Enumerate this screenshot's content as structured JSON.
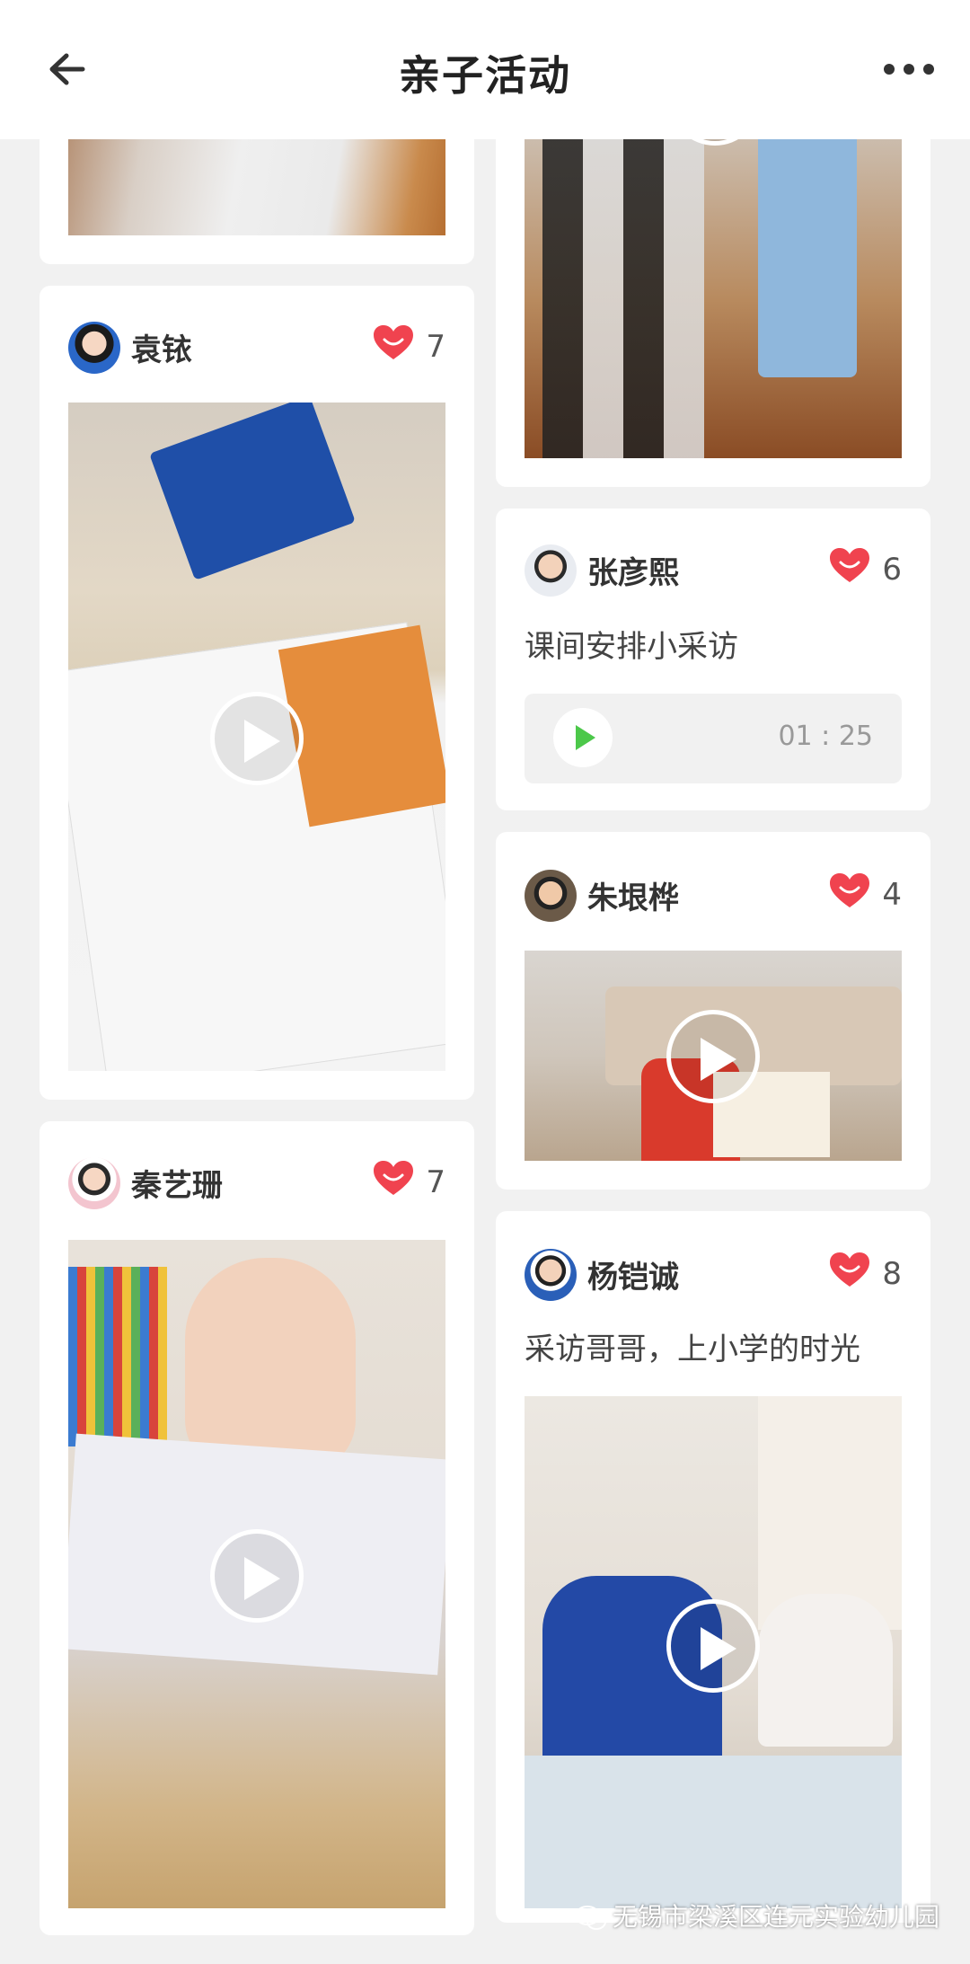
{
  "header": {
    "title": "亲子活动"
  },
  "posts": [
    {
      "name": "袁铱",
      "likes": "7"
    },
    {
      "name": "秦艺珊",
      "likes": "7"
    },
    {
      "name": "张彦熙",
      "likes": "6",
      "caption": "课间安排小采访",
      "audio_duration": "01 : 25"
    },
    {
      "name": "朱垠桦",
      "likes": "4"
    },
    {
      "name": "杨铠诚",
      "likes": "8",
      "caption": "采访哥哥，上小学的时光"
    }
  ],
  "footer": {
    "watermark": "无锡市梁溪区连元实验幼儿园"
  },
  "colors": {
    "like": "#f0434f",
    "play_green": "#4cc84a",
    "background": "#f1f1f1"
  }
}
